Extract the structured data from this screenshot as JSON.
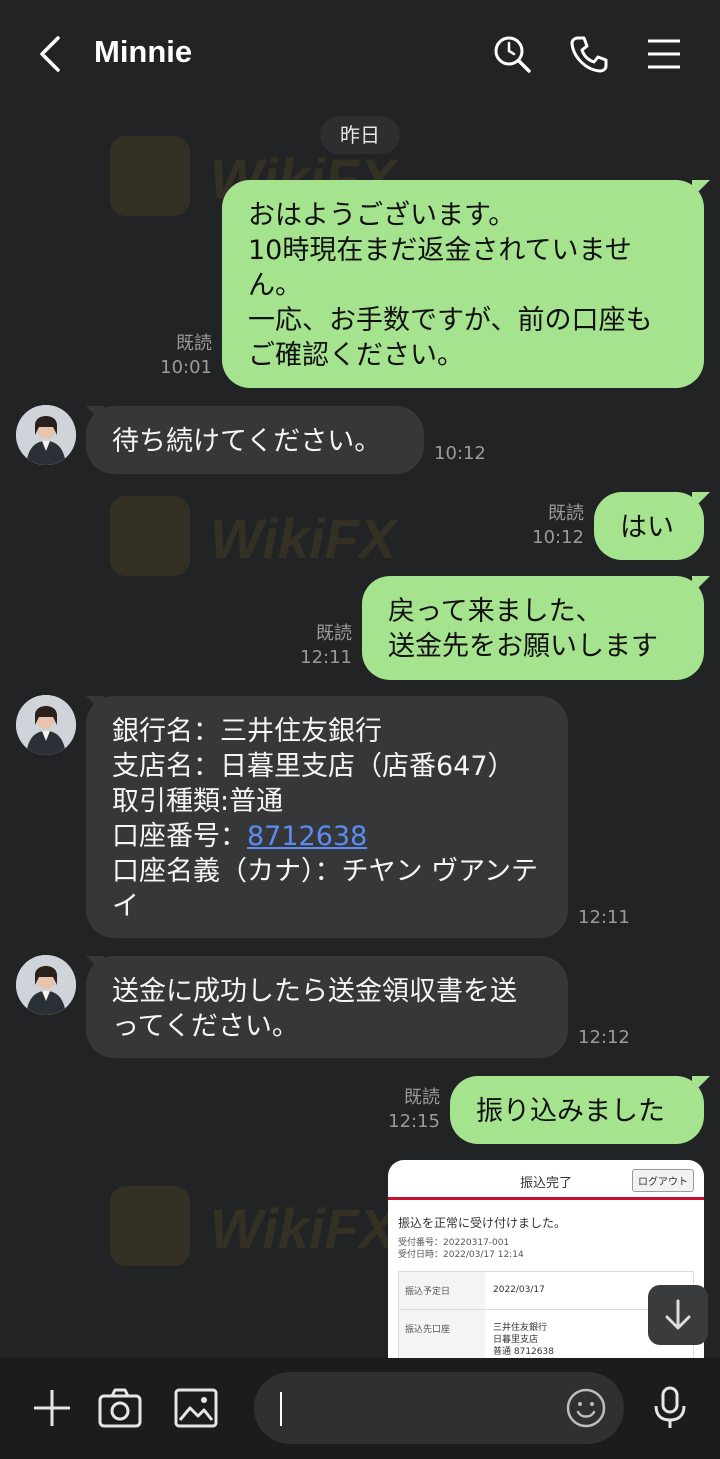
{
  "header": {
    "title": "Minnie"
  },
  "chat": {
    "date_label": "昨日",
    "messages": [
      {
        "dir": "out",
        "text": "おはようございます。\n10時現在まだ返金されていません。\n一応、お手数ですが、前の口座もご確認ください。",
        "read": "既読",
        "time": "10:01"
      },
      {
        "dir": "in",
        "text": "待ち続けてください。",
        "time": "10:12"
      },
      {
        "dir": "out",
        "text": "はい",
        "read": "既読",
        "time": "10:12"
      },
      {
        "dir": "out",
        "text": "戻って来ました、\n送金先をお願いします",
        "read": "既読",
        "time": "12:11"
      },
      {
        "dir": "in",
        "lines": [
          "銀行名：三井住友銀行",
          "支店名：日暮里支店（店番647）",
          "取引種類:普通"
        ],
        "account_label": "口座番号：",
        "account_number": "8712638",
        "holder": "口座名義（カナ）：チヤン ヴアンテイ",
        "time": "12:11"
      },
      {
        "dir": "in",
        "text": "送金に成功したら送金領収書を送ってください。",
        "time": "12:12"
      },
      {
        "dir": "out",
        "text": "振り込みました",
        "read": "既読",
        "time": "12:15"
      }
    ],
    "receipt": {
      "title": "振込完了",
      "logout": "ログアウト",
      "message": "振込を正常に受け付けました。",
      "reception_no": "受付番号：20220317-001",
      "reception_time": "受付日時：2022/03/17 12:14",
      "rows": [
        {
          "label": "振込予定日",
          "value": "2022/03/17"
        },
        {
          "label": "振込先口座",
          "value": "三井住友銀行\n日暮里支店\n普通 8712638"
        }
      ]
    }
  },
  "watermark": "WikiFX",
  "colors": {
    "outgoing_bubble": "#a6e38f",
    "incoming_bubble": "#363739",
    "background": "#222324",
    "link": "#5c8cf2"
  }
}
